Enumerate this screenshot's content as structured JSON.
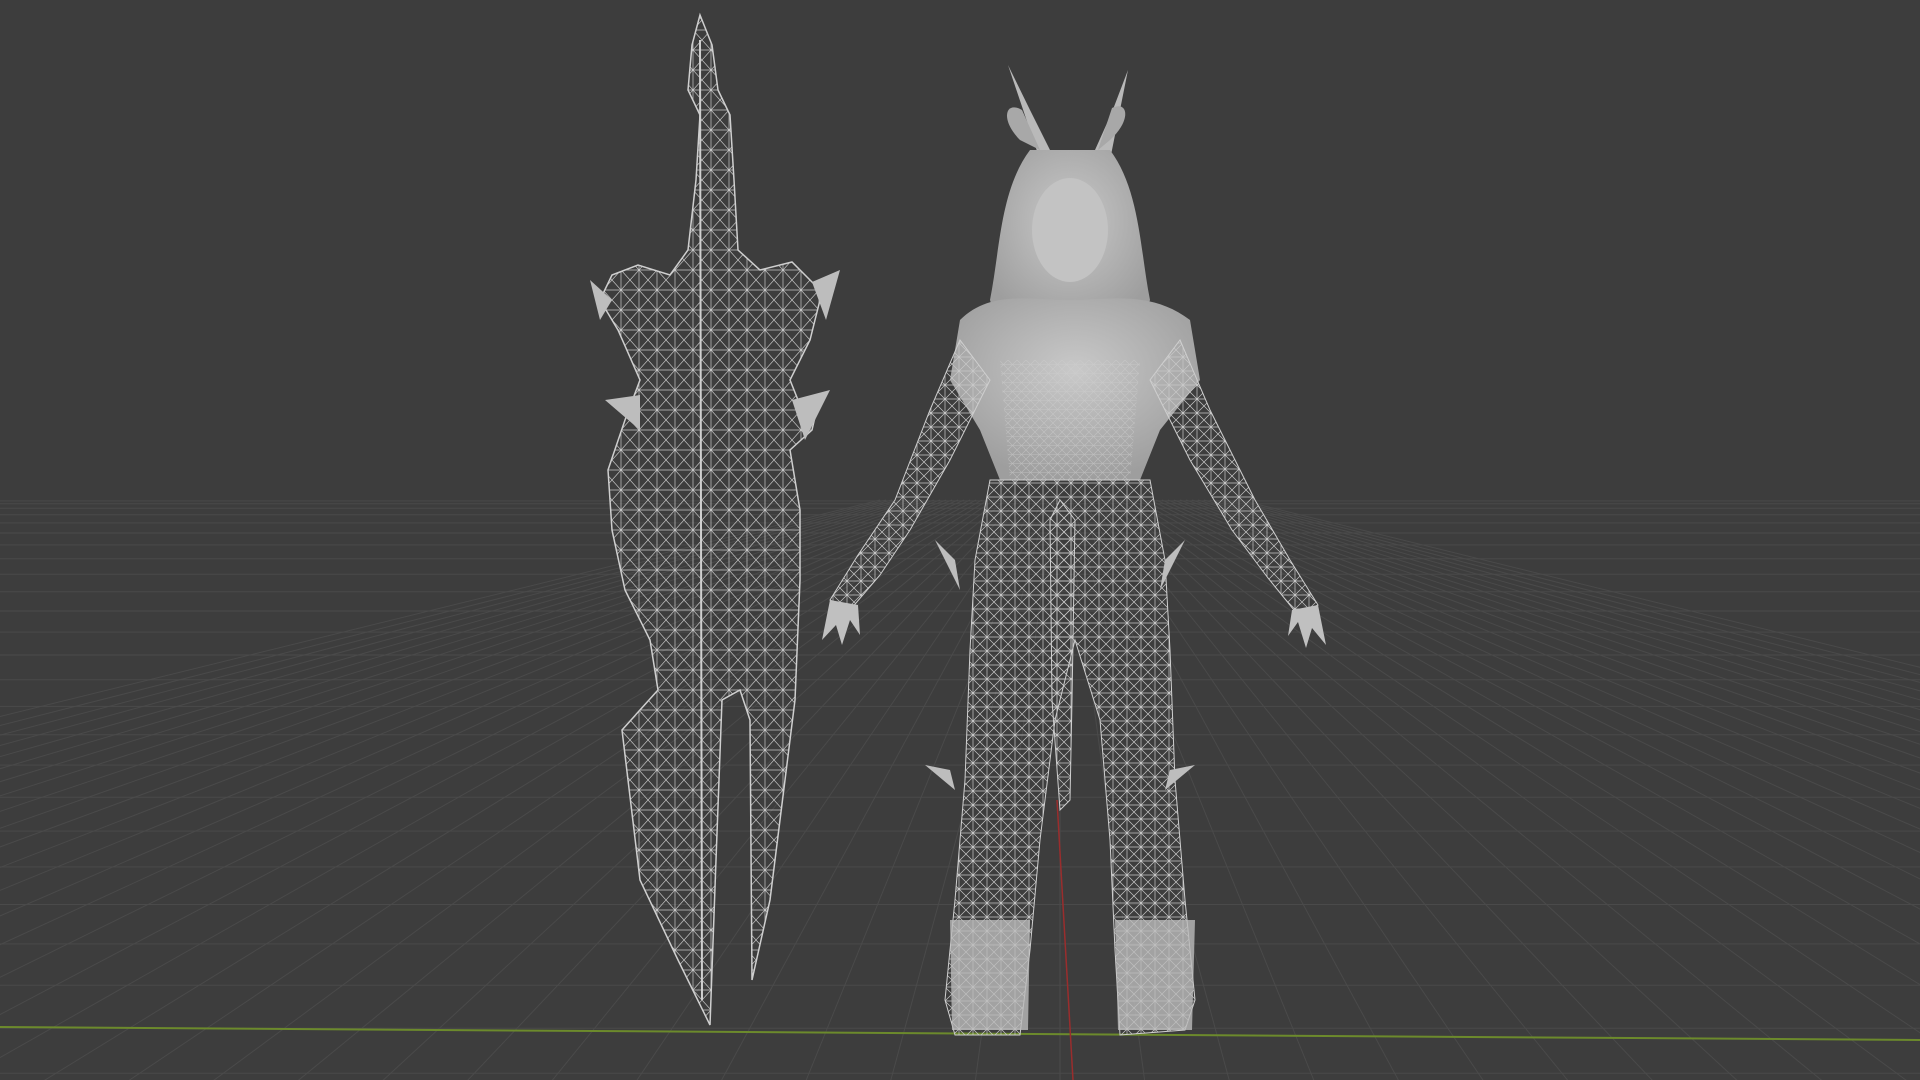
{
  "viewport": {
    "background_color": "#3d3d3d",
    "grid_color": "#4a4a4a",
    "grid_visible": true,
    "x_axis_color": "#6c8a2c",
    "y_axis_color": "#9a2d2d",
    "wireframe_color": "#c8c8c8",
    "shaded_color": "#b5b5b5"
  },
  "scene": {
    "objects": [
      {
        "name": "sword",
        "display": "wireframe"
      },
      {
        "name": "demon-warrior-character",
        "display": "wireframe-over-solid"
      }
    ]
  }
}
